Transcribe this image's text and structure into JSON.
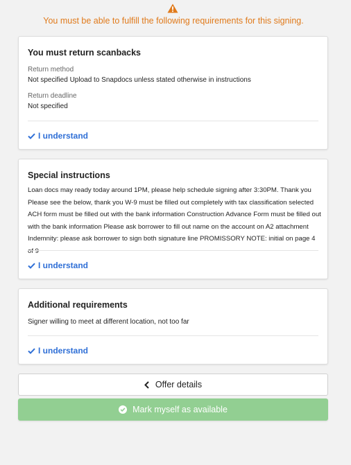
{
  "header": {
    "warning_icon": "warning-triangle-icon",
    "warning_text": "You must be able to fulfill the following requirements for this signing."
  },
  "scanbacks": {
    "title": "You must return scanbacks",
    "return_method_label": "Return method",
    "return_method_value": "Not specified Upload to Snapdocs unless stated otherwise in instructions",
    "return_deadline_label": "Return deadline",
    "return_deadline_value": "Not specified",
    "understand_label": "I understand"
  },
  "special": {
    "title": "Special instructions",
    "text": "Loan docs may ready today around 1PM, please help schedule signing after 3:30PM. Thank you Please see the below, thank you W-9 must be filled out completely with tax classification selected ACH form must be filled out with the bank information Construction Advance Form must be filled out with the bank information Please ask borrower to fill out name on the account on A2 attachment Indemnity: please ask borrower to sign both signature line PROMISSORY NOTE: initial on page 4 of 9",
    "understand_label": "I understand"
  },
  "additional": {
    "title": "Additional requirements",
    "text": "Signer willing to meet at different location, not too far",
    "understand_label": "I understand"
  },
  "actions": {
    "offer_details_label": "Offer details",
    "mark_available_label": "Mark myself as available"
  },
  "colors": {
    "warning": "#e07a1b",
    "link": "#2f6fd6",
    "available_button": "#92cf92"
  }
}
